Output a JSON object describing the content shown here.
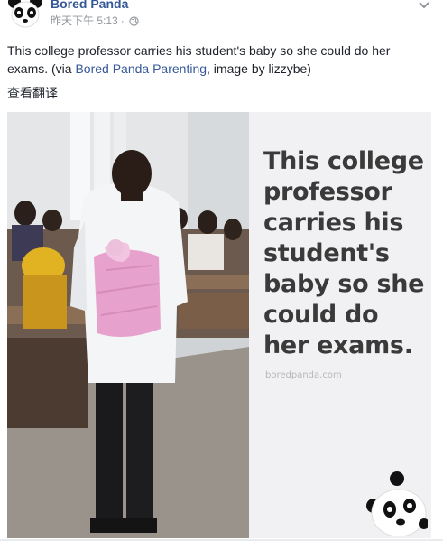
{
  "post": {
    "page_name": "Bored Panda",
    "timestamp": "昨天下午 5:13",
    "caption_prefix": "This college professor carries his student's baby so she could do her exams. (via ",
    "caption_link_1": "Bored Panda Parenting",
    "caption_middle": ", image by lizzybe)",
    "translate_label": "查看翻译"
  },
  "image": {
    "headline": "This college professor carries his student's baby so she could do her exams.",
    "watermark": "boredpanda.com"
  },
  "icons": {
    "avatar": "panda-avatar",
    "privacy": "globe-icon",
    "options": "chevron-down-icon",
    "logo": "panda-logo"
  },
  "colors": {
    "link": "#365899",
    "meta": "#90949c",
    "panel_bg": "#f1f0f2",
    "headline": "#3a3a3a"
  }
}
